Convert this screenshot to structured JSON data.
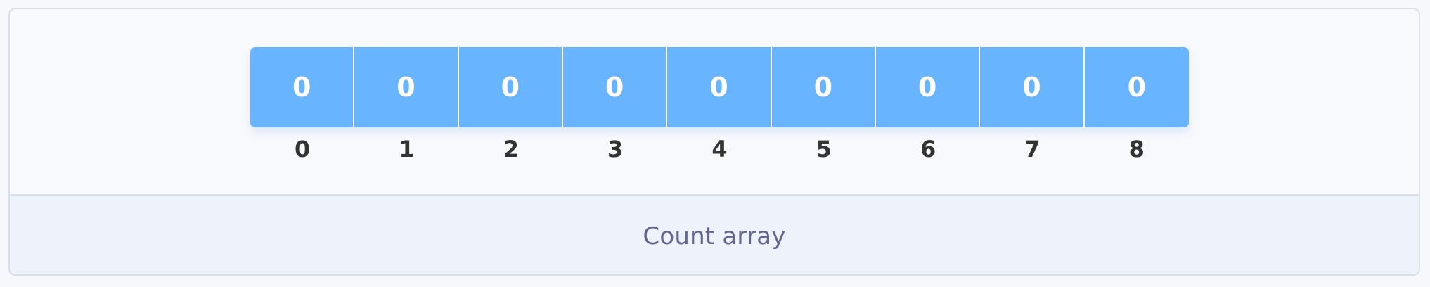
{
  "count_array": {
    "values": [
      "0",
      "0",
      "0",
      "0",
      "0",
      "0",
      "0",
      "0",
      "0"
    ],
    "indices": [
      "0",
      "1",
      "2",
      "3",
      "4",
      "5",
      "6",
      "7",
      "8"
    ],
    "caption": "Count array"
  },
  "colors": {
    "cell_fill": "#69b4ff",
    "cell_text": "#ffffff",
    "index_text": "#333333",
    "caption_text": "#62668c",
    "caption_background": "#eef3fb",
    "frame_border": "#d9dee8"
  }
}
